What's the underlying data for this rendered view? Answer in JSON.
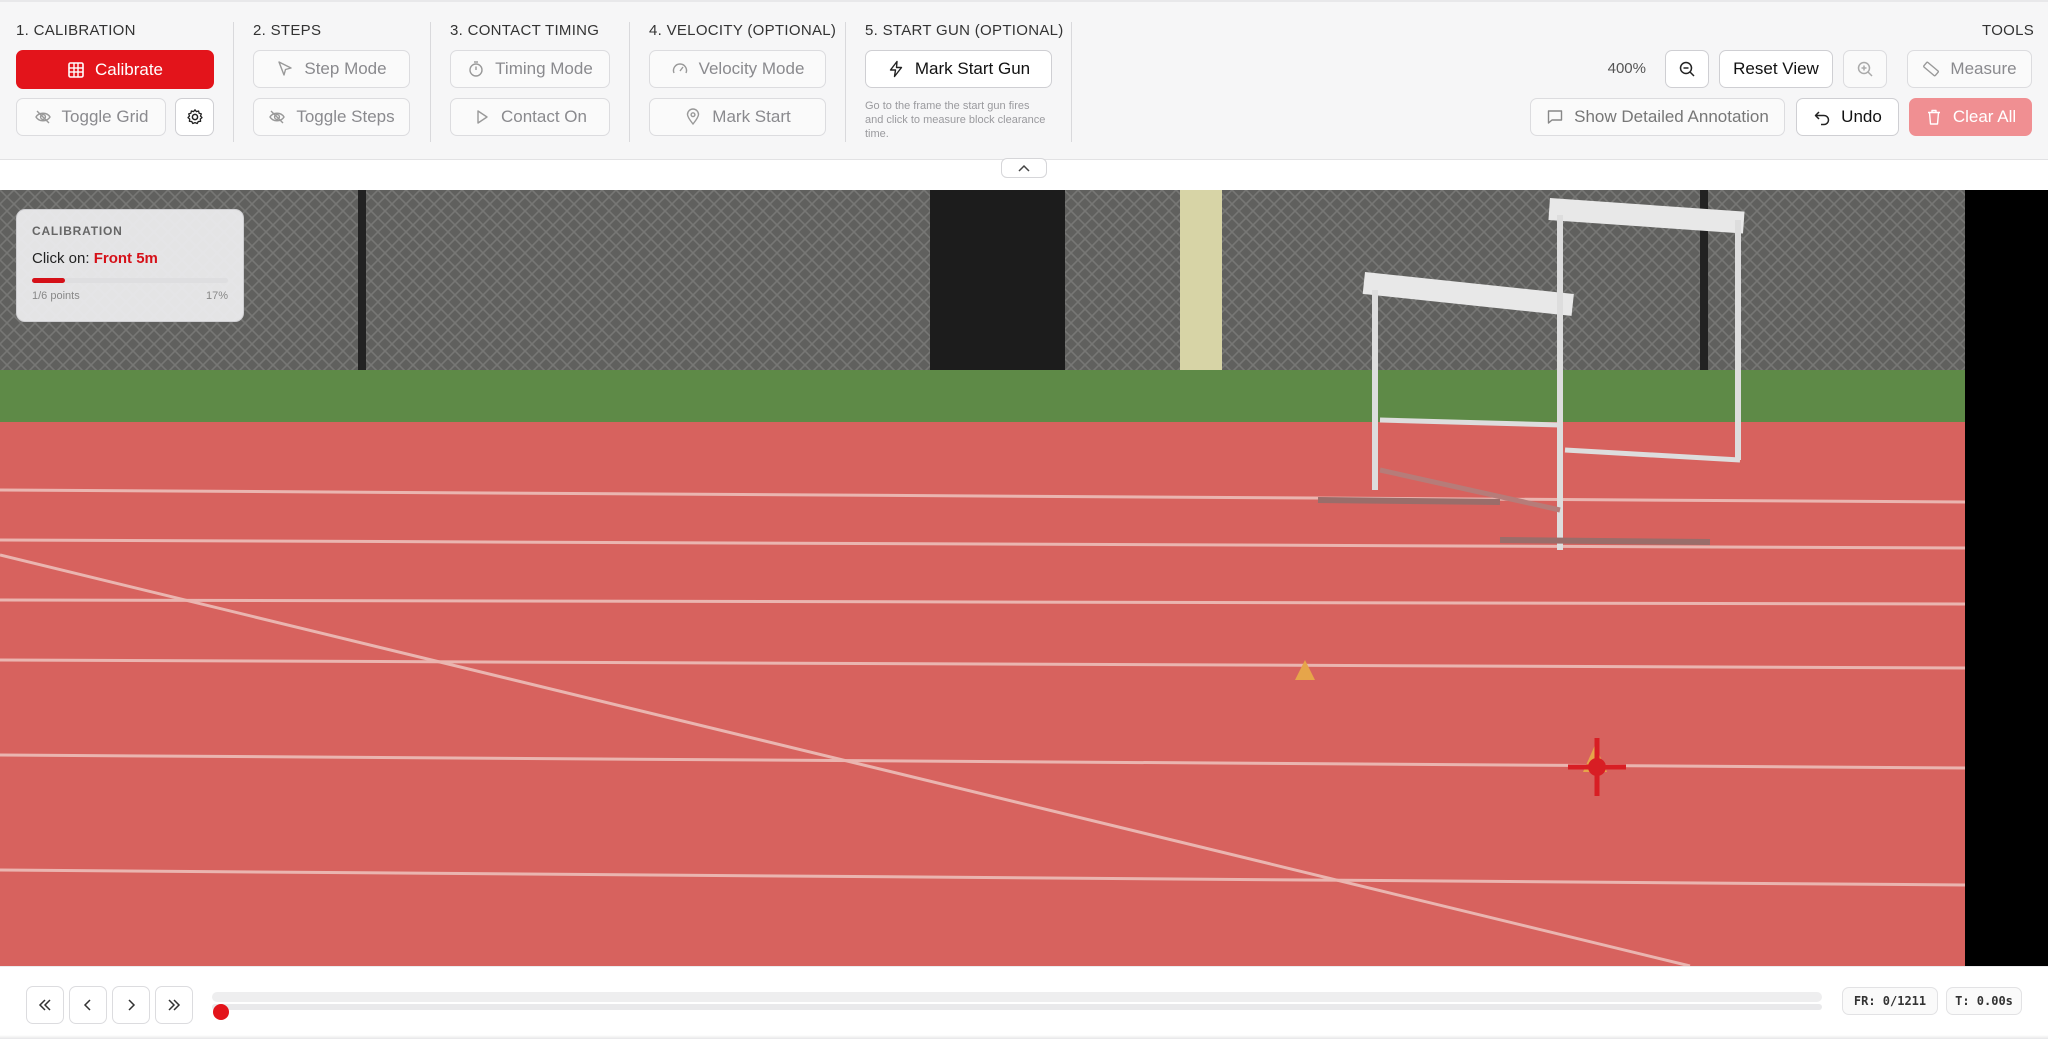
{
  "toolbar": {
    "calibration": {
      "title": "1. CALIBRATION",
      "calibrate_label": "Calibrate",
      "toggle_grid_label": "Toggle Grid"
    },
    "steps": {
      "title": "2. STEPS",
      "step_mode_label": "Step Mode",
      "toggle_steps_label": "Toggle Steps"
    },
    "contact_timing": {
      "title": "3. CONTACT TIMING",
      "timing_mode_label": "Timing Mode",
      "contact_on_label": "Contact On"
    },
    "velocity": {
      "title": "4. VELOCITY (OPTIONAL)",
      "velocity_mode_label": "Velocity Mode",
      "mark_start_label": "Mark Start"
    },
    "start_gun": {
      "title": "5. START GUN (OPTIONAL)",
      "mark_start_gun_label": "Mark Start Gun",
      "hint": "Go to the frame the start gun fires and click to measure block clearance time."
    },
    "tools": {
      "title": "TOOLS",
      "zoom_level": "400%",
      "reset_view_label": "Reset View",
      "measure_label": "Measure",
      "show_annotation_label": "Show Detailed Annotation",
      "undo_label": "Undo",
      "clear_all_label": "Clear All"
    }
  },
  "calibration_overlay": {
    "title": "CALIBRATION",
    "click_prefix": "Click on:",
    "target": "Front 5m",
    "points_text": "1/6 points",
    "percent_text": "17%",
    "progress": 0.17
  },
  "playback": {
    "frame_readout": "FR: 0/1211",
    "time_readout": "T: 0.00s",
    "position": 0
  },
  "colors": {
    "accent": "#e3141b",
    "track_overlay": "#d9605c"
  },
  "icons": [
    "grid-icon",
    "eye-off-icon",
    "gear-icon",
    "cursor-icon",
    "stopwatch-icon",
    "play-icon",
    "gauge-icon",
    "map-pin-icon",
    "lightning-icon",
    "zoom-out-icon",
    "zoom-in-icon",
    "ruler-icon",
    "comment-icon",
    "undo-icon",
    "trash-icon",
    "chevron-up-icon",
    "skip-back-icon",
    "step-back-icon",
    "step-forward-icon",
    "skip-forward-icon"
  ]
}
